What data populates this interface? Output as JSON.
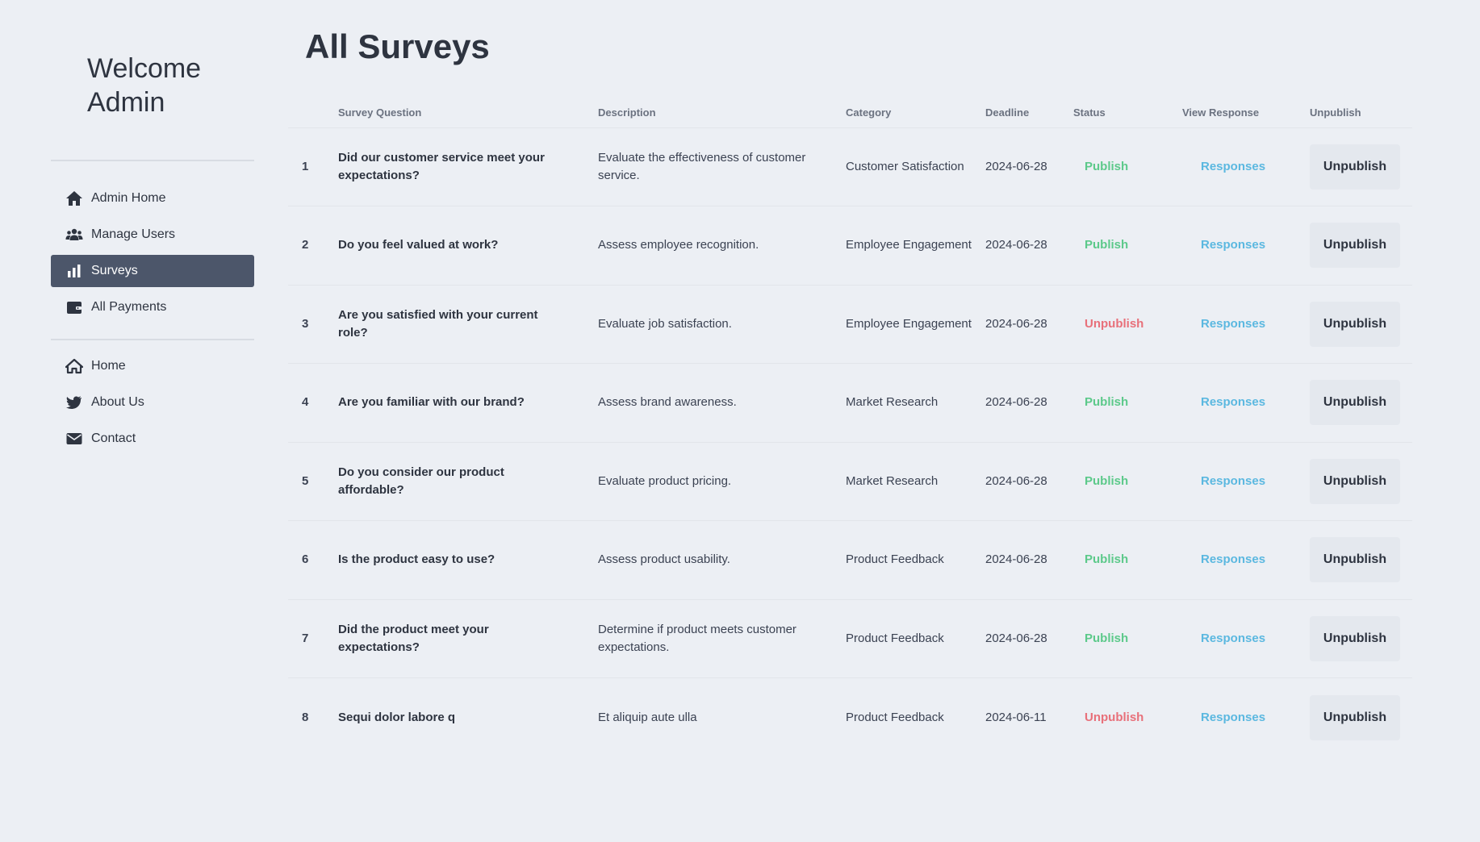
{
  "sidebar": {
    "welcome_line1": "Welcome",
    "welcome_line2": "Admin",
    "primary_items": [
      {
        "label": "Admin Home",
        "icon": "home-icon"
      },
      {
        "label": "Manage Users",
        "icon": "users-icon"
      },
      {
        "label": "Surveys",
        "icon": "bar-chart-icon",
        "active": true
      },
      {
        "label": "All Payments",
        "icon": "wallet-icon"
      }
    ],
    "secondary_items": [
      {
        "label": "Home",
        "icon": "home-outline-icon"
      },
      {
        "label": "About Us",
        "icon": "bird-icon"
      },
      {
        "label": "Contact",
        "icon": "envelope-icon"
      }
    ]
  },
  "main": {
    "title": "All Surveys",
    "columns": [
      "",
      "Survey Question",
      "Description",
      "Category",
      "Deadline",
      "Status",
      "View Response",
      "Unpublish"
    ],
    "rows": [
      {
        "num": "1",
        "question": "Did our customer service meet your expectations?",
        "description": "Evaluate the effectiveness of customer service.",
        "category": "Customer Satisfaction",
        "deadline": "2024-06-28",
        "status": "Publish",
        "response": "Responses",
        "action": "Unpublish"
      },
      {
        "num": "2",
        "question": "Do you feel valued at work?",
        "description": "Assess employee recognition.",
        "category": "Employee Engagement",
        "deadline": "2024-06-28",
        "status": "Publish",
        "response": "Responses",
        "action": "Unpublish"
      },
      {
        "num": "3",
        "question": "Are you satisfied with your current role?",
        "description": "Evaluate job satisfaction.",
        "category": "Employee Engagement",
        "deadline": "2024-06-28",
        "status": "Unpublish",
        "response": "Responses",
        "action": "Unpublish"
      },
      {
        "num": "4",
        "question": "Are you familiar with our brand?",
        "description": "Assess brand awareness.",
        "category": "Market Research",
        "deadline": "2024-06-28",
        "status": "Publish",
        "response": "Responses",
        "action": "Unpublish"
      },
      {
        "num": "5",
        "question": "Do you consider our product affordable?",
        "description": "Evaluate product pricing.",
        "category": "Market Research",
        "deadline": "2024-06-28",
        "status": "Publish",
        "response": "Responses",
        "action": "Unpublish"
      },
      {
        "num": "6",
        "question": "Is the product easy to use?",
        "description": "Assess product usability.",
        "category": "Product Feedback",
        "deadline": "2024-06-28",
        "status": "Publish",
        "response": "Responses",
        "action": "Unpublish"
      },
      {
        "num": "7",
        "question": "Did the product meet your expectations?",
        "description": "Determine if product meets customer expectations.",
        "category": "Product Feedback",
        "deadline": "2024-06-28",
        "status": "Publish",
        "response": "Responses",
        "action": "Unpublish"
      },
      {
        "num": "8",
        "question": "Sequi dolor labore q",
        "description": "Et aliquip aute ulla",
        "category": "Product Feedback",
        "deadline": "2024-06-11",
        "status": "Unpublish",
        "response": "Responses",
        "action": "Unpublish"
      }
    ]
  },
  "colors": {
    "background": "#eceff4",
    "active_nav": "#4c566a",
    "publish": "#5cc98a",
    "unpublish": "#e8707a",
    "link": "#5bb8e0"
  }
}
